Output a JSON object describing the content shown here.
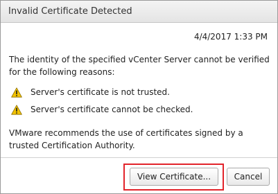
{
  "dialog": {
    "title": "Invalid Certificate Detected",
    "timestamp": "4/4/2017 1:33 PM",
    "message": "The identity of the specified vCenter Server cannot be verified for the following reasons:",
    "reasons": [
      {
        "icon": "warning-icon",
        "text": "Server's certificate is not trusted."
      },
      {
        "icon": "warning-icon",
        "text": "Server's certificate cannot be checked."
      }
    ],
    "recommendation": "VMware recommends the use of certificates signed by a trusted Certification Authority."
  },
  "buttons": {
    "view_certificate": "View Certificate...",
    "cancel": "Cancel"
  },
  "colors": {
    "warning": "#f2c200",
    "highlight": "#e2232a"
  }
}
